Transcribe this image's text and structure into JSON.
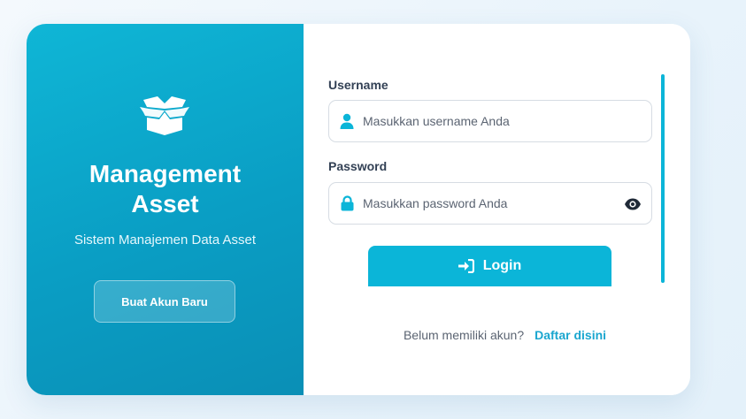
{
  "brand": {
    "title_line1": "Management",
    "title_line2": "Asset",
    "subtitle": "Sistem Manajemen Data Asset",
    "create_account_label": "Buat Akun Baru",
    "icon": "box-open-icon"
  },
  "form": {
    "username_label": "Username",
    "username_placeholder": "Masukkan username Anda",
    "username_icon": "user-icon",
    "password_label": "Password",
    "password_placeholder": "Masukkan password Anda",
    "password_icon": "lock-icon",
    "toggle_icon": "eye-icon",
    "login_label": "Login",
    "login_icon": "sign-in-icon"
  },
  "register": {
    "prompt": "Belum memiliki akun?",
    "link_label": "Daftar disini"
  },
  "colors": {
    "accent": "#0bb5d8",
    "panel_start": "#0fb6d6",
    "panel_end": "#0a8fb6",
    "link": "#1aa6cf"
  }
}
